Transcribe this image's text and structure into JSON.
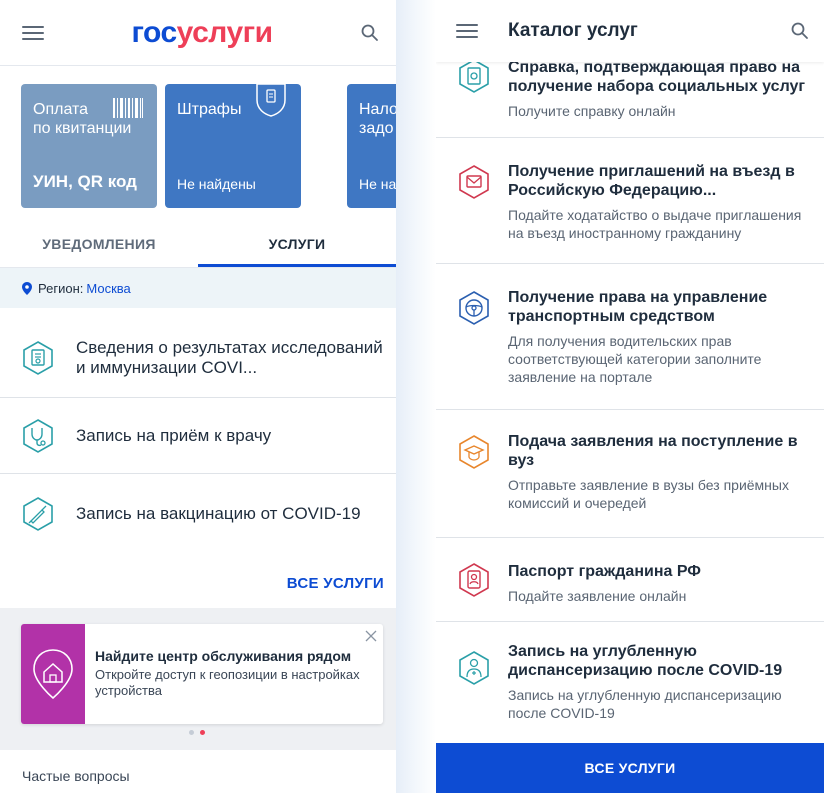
{
  "left": {
    "logo": {
      "part1": "гос",
      "part2": "услуги"
    },
    "cards": [
      {
        "title": "Оплата\nпо квитанции",
        "value": "УИН, QR код"
      },
      {
        "title": "Штрафы",
        "value": "Не найдены"
      },
      {
        "title": "Нало\nзадо",
        "value": "Не на"
      }
    ],
    "tabs": [
      {
        "label": "УВЕДОМЛЕНИЯ"
      },
      {
        "label": "УСЛУГИ"
      }
    ],
    "region": {
      "label": "Регион:",
      "value": "Москва"
    },
    "services": [
      {
        "name": "Сведения о результатах исследований и иммунизации COVI..."
      },
      {
        "name": "Запись на приём к врачу"
      },
      {
        "name": "Запись на вакцинацию от COVID-19"
      }
    ],
    "all_services_link": "ВСЕ УСЛУГИ",
    "promo": {
      "title": "Найдите центр обслуживания рядом",
      "text": "Откройте доступ к геопозиции в настройках устройства"
    },
    "faq_label": "Частые вопросы"
  },
  "right": {
    "title": "Каталог услуг",
    "items": [
      {
        "title": "Справка, подтверждающая право на получение набора социальных услуг",
        "desc": "Получите справку онлайн"
      },
      {
        "title": "Получение приглашений на въезд в Российскую Федерацию...",
        "desc": "Подайте ходатайство о выдаче приглашения на въезд иностранному гражданину"
      },
      {
        "title": "Получение права на управление транспортным средством",
        "desc": "Для получения водительских прав соответствующей категории заполните заявление на портале"
      },
      {
        "title": "Подача заявления на поступление в вуз",
        "desc": "Отправьте заявление в вузы без приёмных комиссий и очередей"
      },
      {
        "title": "Паспорт гражданина РФ",
        "desc": "Подайте заявление онлайн"
      },
      {
        "title": "Запись на углубленную диспансеризацию после COVID-19",
        "desc": "Запись на углубленную диспансеризацию после COVID-19"
      }
    ],
    "all_services_button": "ВСЕ УСЛУГИ"
  },
  "colors": {
    "brand_blue": "#0d4cd3",
    "brand_red": "#ee3f58",
    "card_grey_blue": "#7a9cc1",
    "card_blue": "#3f77c3",
    "promo_purple": "#b232a8",
    "icon_teal": "#2a9fa8",
    "icon_red": "#d0384f",
    "icon_orange": "#e8862c",
    "icon_blue": "#2b5fb0"
  },
  "icons": [
    "menu-icon",
    "search-icon",
    "barcode-icon",
    "shield-icon",
    "location-pin-icon",
    "medical-document-icon",
    "stethoscope-icon",
    "syringe-icon",
    "home-location-icon",
    "close-icon",
    "certificate-icon",
    "invitation-icon",
    "steering-wheel-icon",
    "graduation-cap-icon",
    "passport-icon",
    "doctor-icon"
  ]
}
